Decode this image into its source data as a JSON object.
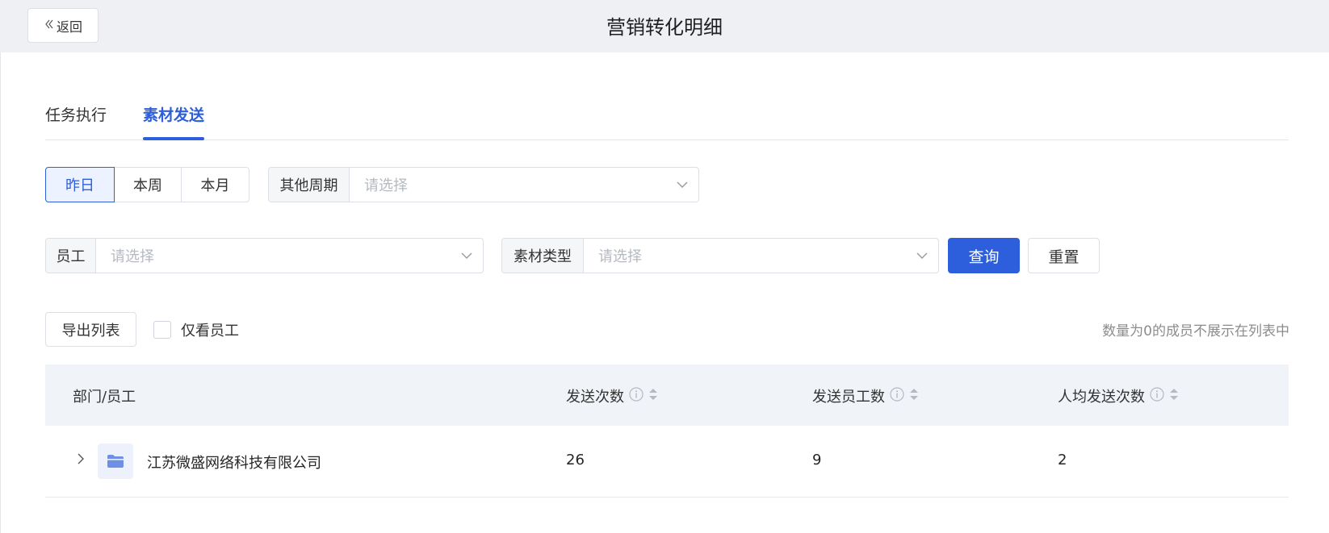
{
  "header": {
    "back_label": "返回",
    "title": "营销转化明细"
  },
  "tabs": [
    {
      "label": "任务执行"
    },
    {
      "label": "素材发送"
    }
  ],
  "filters": {
    "periods": [
      {
        "label": "昨日"
      },
      {
        "label": "本周"
      },
      {
        "label": "本月"
      }
    ],
    "other_period": {
      "label": "其他周期",
      "placeholder": "请选择"
    },
    "employee": {
      "label": "员工",
      "placeholder": "请选择"
    },
    "material_type": {
      "label": "素材类型",
      "placeholder": "请选择"
    },
    "query_label": "查询",
    "reset_label": "重置"
  },
  "toolbar": {
    "export_label": "导出列表",
    "only_employees_label": "仅看员工",
    "hint": "数量为0的成员不展示在列表中"
  },
  "table": {
    "columns": [
      "部门/员工",
      "发送次数",
      "发送员工数",
      "人均发送次数"
    ],
    "rows": [
      {
        "name": "江苏微盛网络科技有限公司",
        "sends": "26",
        "senders": "9",
        "avg": "2"
      }
    ]
  },
  "colors": {
    "accent": "#2d5fdc",
    "header_bg": "#eef0f3",
    "table_header_bg": "#f0f3f8"
  }
}
